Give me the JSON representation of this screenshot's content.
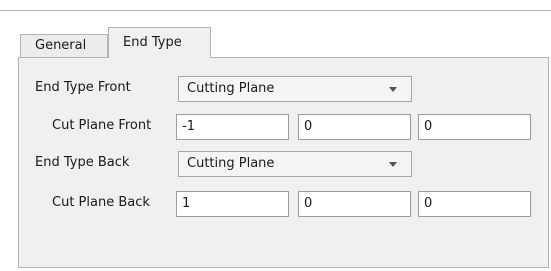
{
  "tabs": [
    {
      "label": "General"
    },
    {
      "label": "End Type"
    }
  ],
  "end_type_front": {
    "label": "End Type Front",
    "selected": "Cutting Plane"
  },
  "cut_plane_front": {
    "label": "Cut Plane Front",
    "values": [
      "-1",
      "0",
      "0"
    ]
  },
  "end_type_back": {
    "label": "End Type Back",
    "selected": "Cutting Plane"
  },
  "cut_plane_back": {
    "label": "Cut Plane Back",
    "values": [
      "1",
      "0",
      "0"
    ]
  }
}
